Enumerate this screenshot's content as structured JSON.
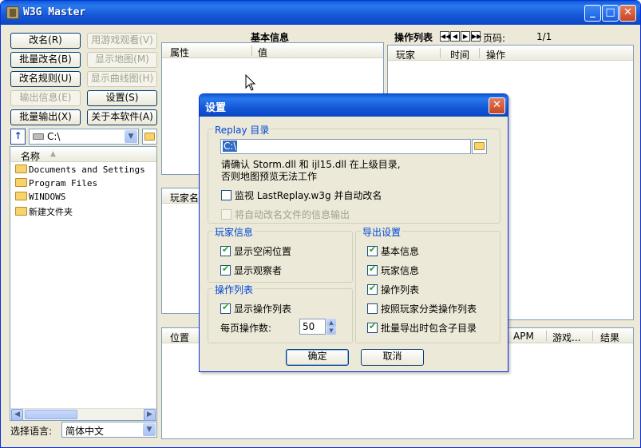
{
  "app": {
    "title": "W3G Master"
  },
  "buttons": {
    "rename": "改名(R)",
    "batch_rename": "批量改名(B)",
    "rename_rules": "改名规则(U)",
    "output_info": "输出信息(E)",
    "batch_output": "批量输出(X)",
    "watch_game": "用游戏观看(V)",
    "show_map": "显示地图(M)",
    "show_curve": "显示曲线图(H)",
    "settings": "设置(S)",
    "about": "关于本软件(A)"
  },
  "drive": {
    "value": "C:\\"
  },
  "file_list": {
    "header": "名称",
    "items": [
      "Documents and Settings",
      "Program Files",
      "WINDOWS",
      "新建文件夹"
    ]
  },
  "language": {
    "label": "选择语言:",
    "value": "简体中文"
  },
  "basic_info": {
    "title": "基本信息",
    "col_attr": "属性",
    "col_value": "值"
  },
  "action_list": {
    "title": "操作列表",
    "page_label": "页码:",
    "page_value": "1/1",
    "col_player": "玩家",
    "col_time": "时间",
    "col_action": "操作"
  },
  "player_panel": {
    "col_name": "玩家名"
  },
  "bottom_table": {
    "col_position": "位置",
    "col_apm": "APM",
    "col_game": "游戏...",
    "col_result": "结果"
  },
  "dialog": {
    "title": "设置",
    "replay_group": "Replay 目录",
    "replay_path": "C:\\",
    "note_line1": "请确认 Storm.dll 和 ijl15.dll 在上级目录,",
    "note_line2": "否则地图预览无法工作",
    "monitor_label": "监视 LastReplay.w3g 并自动改名",
    "auto_output_label": "将自动改名文件的信息输出",
    "player_group": "玩家信息",
    "show_slots": "显示空闲位置",
    "show_observers": "显示观察者",
    "actions_group": "操作列表",
    "show_actions": "显示操作列表",
    "per_page_label": "每页操作数:",
    "per_page_value": "50",
    "export_group": "导出设置",
    "export_basic": "基本信息",
    "export_players": "玩家信息",
    "export_actions": "操作列表",
    "export_by_player": "按照玩家分类操作列表",
    "export_subdirs": "批量导出时包含子目录",
    "ok": "确定",
    "cancel": "取消"
  }
}
